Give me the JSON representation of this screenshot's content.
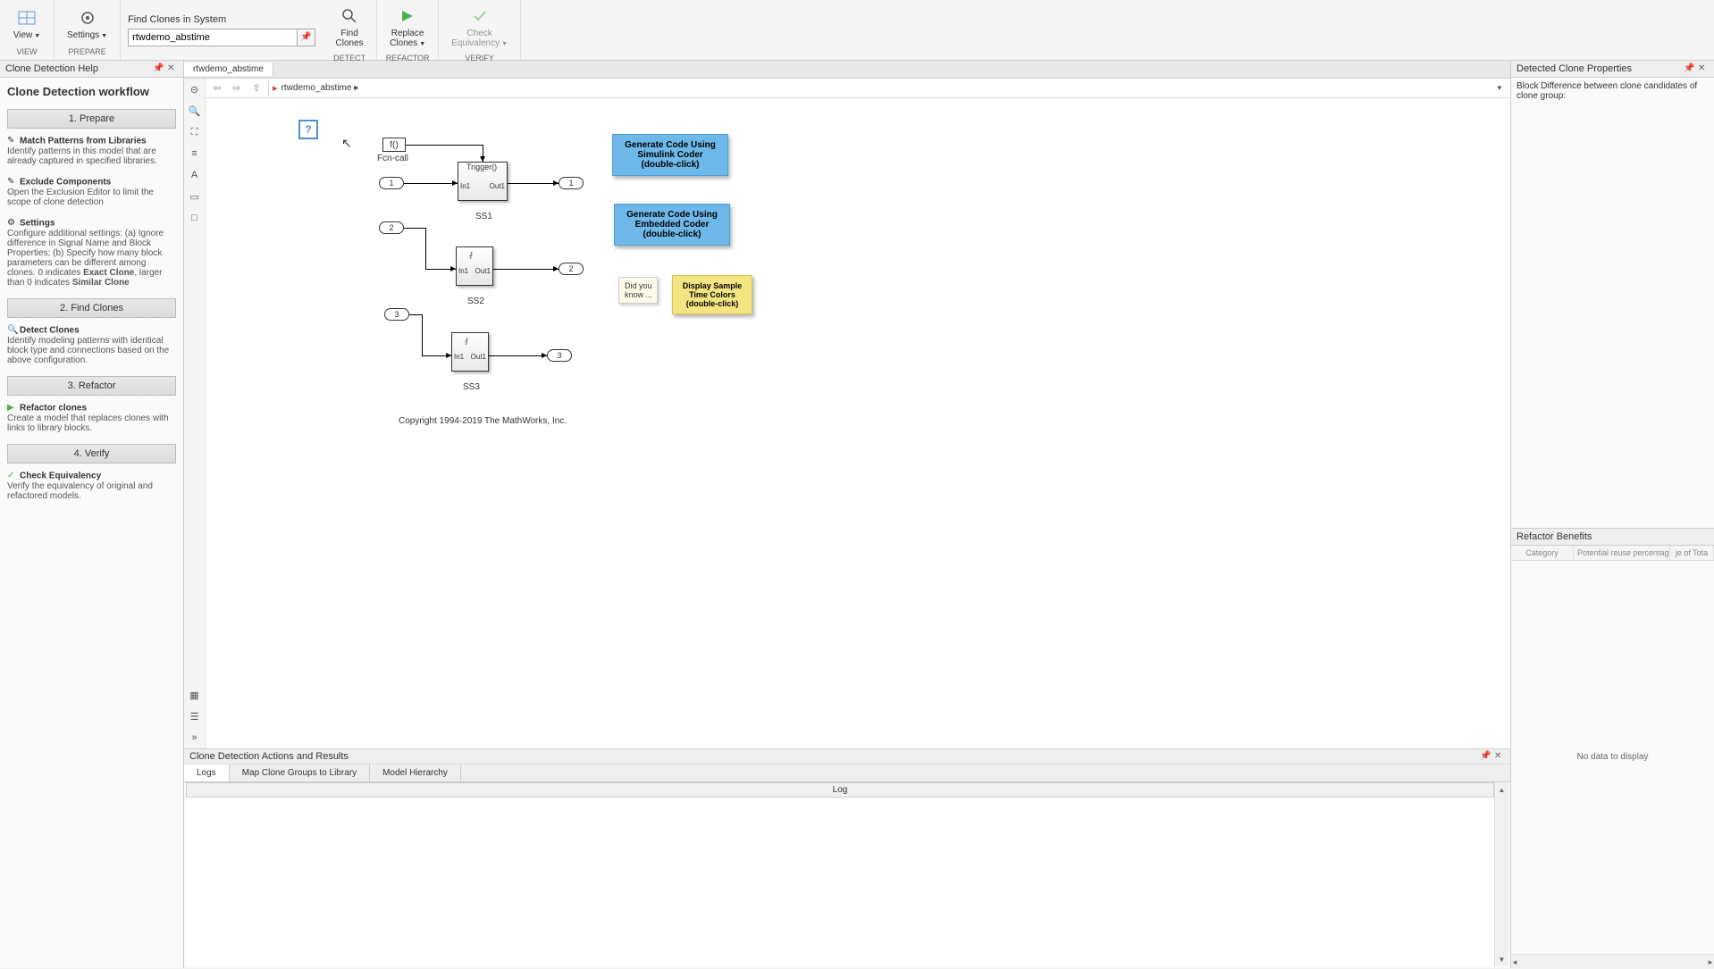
{
  "toolbar": {
    "view_label": "View",
    "settings_label": "Settings",
    "find_label": "Find\nClones",
    "replace_label": "Replace\nClones",
    "check_label": "Check\nEquivalency",
    "section_view": "VIEW",
    "section_prepare": "PREPARE",
    "section_detect": "DETECT",
    "section_refactor": "REFACTOR",
    "section_verify": "VERIFY",
    "search_title": "Find Clones in System",
    "search_value": "rtwdemo_abstime"
  },
  "left": {
    "header": "Clone Detection Help",
    "title": "Clone Detection workflow",
    "steps": {
      "s1": "1. Prepare",
      "s2": "2. Find Clones",
      "s3": "3. Refactor",
      "s4": "4. Verify"
    },
    "items": {
      "match_title": "Match Patterns from Libraries",
      "match_desc": "Identify patterns in this model that are already captured in specified libraries.",
      "exclude_title": "Exclude Components",
      "exclude_desc": "Open the Exclusion Editor to limit the scope of clone detection",
      "settings_title": "Settings",
      "settings_desc": "Configure additional settings: (a) Ignore difference in Signal Name and Block Properties; (b) Specify how many block parameters can be different among clones. 0 indicates Exact Clone, larger than 0 indicates Similar Clone",
      "detect_title": "Detect Clones",
      "detect_desc": "Identify modeling patterns with identical block type and connections based on the above configuration.",
      "refactor_title": "Refactor clones",
      "refactor_desc": "Create a model that replaces clones with links to library blocks.",
      "checkeq_title": "Check Equivalency",
      "checkeq_desc": "Verify the equivalency of original and refactored models."
    }
  },
  "center": {
    "tab": "rtwdemo_abstime",
    "breadcrumb": "rtwdemo_abstime",
    "blocks": {
      "help": "?",
      "fcn": "f()",
      "fcn_label": "Fcn-call",
      "trigger": "Trigger()",
      "ss1": "SS1",
      "ss2": "SS2",
      "ss3": "SS3",
      "in1": "In1",
      "out1": "Out1",
      "p1": "1",
      "p2": "2",
      "p3": "3",
      "btn1": "Generate Code Using\nSimulink Coder\n(double-click)",
      "btn2": "Generate Code Using\nEmbedded Coder\n(double-click)",
      "btn3": "Display Sample\nTime Colors\n(double-click)",
      "didyou": "Did you\nknow ..."
    },
    "copyright": "Copyright 1994-2019 The MathWorks, Inc."
  },
  "bottom": {
    "header": "Clone Detection Actions and Results",
    "tabs": {
      "logs": "Logs",
      "map": "Map Clone Groups to Library",
      "model": "Model Hierarchy"
    },
    "log_col": "Log"
  },
  "right": {
    "header": "Detected Clone Properties",
    "desc": "Block Difference between clone candidates of clone group:",
    "sub": "Refactor Benefits",
    "cols": {
      "cat": "Category",
      "pot": "Potential reuse percentage",
      "tot": "je of Tota"
    },
    "nodata": "No data to display"
  }
}
